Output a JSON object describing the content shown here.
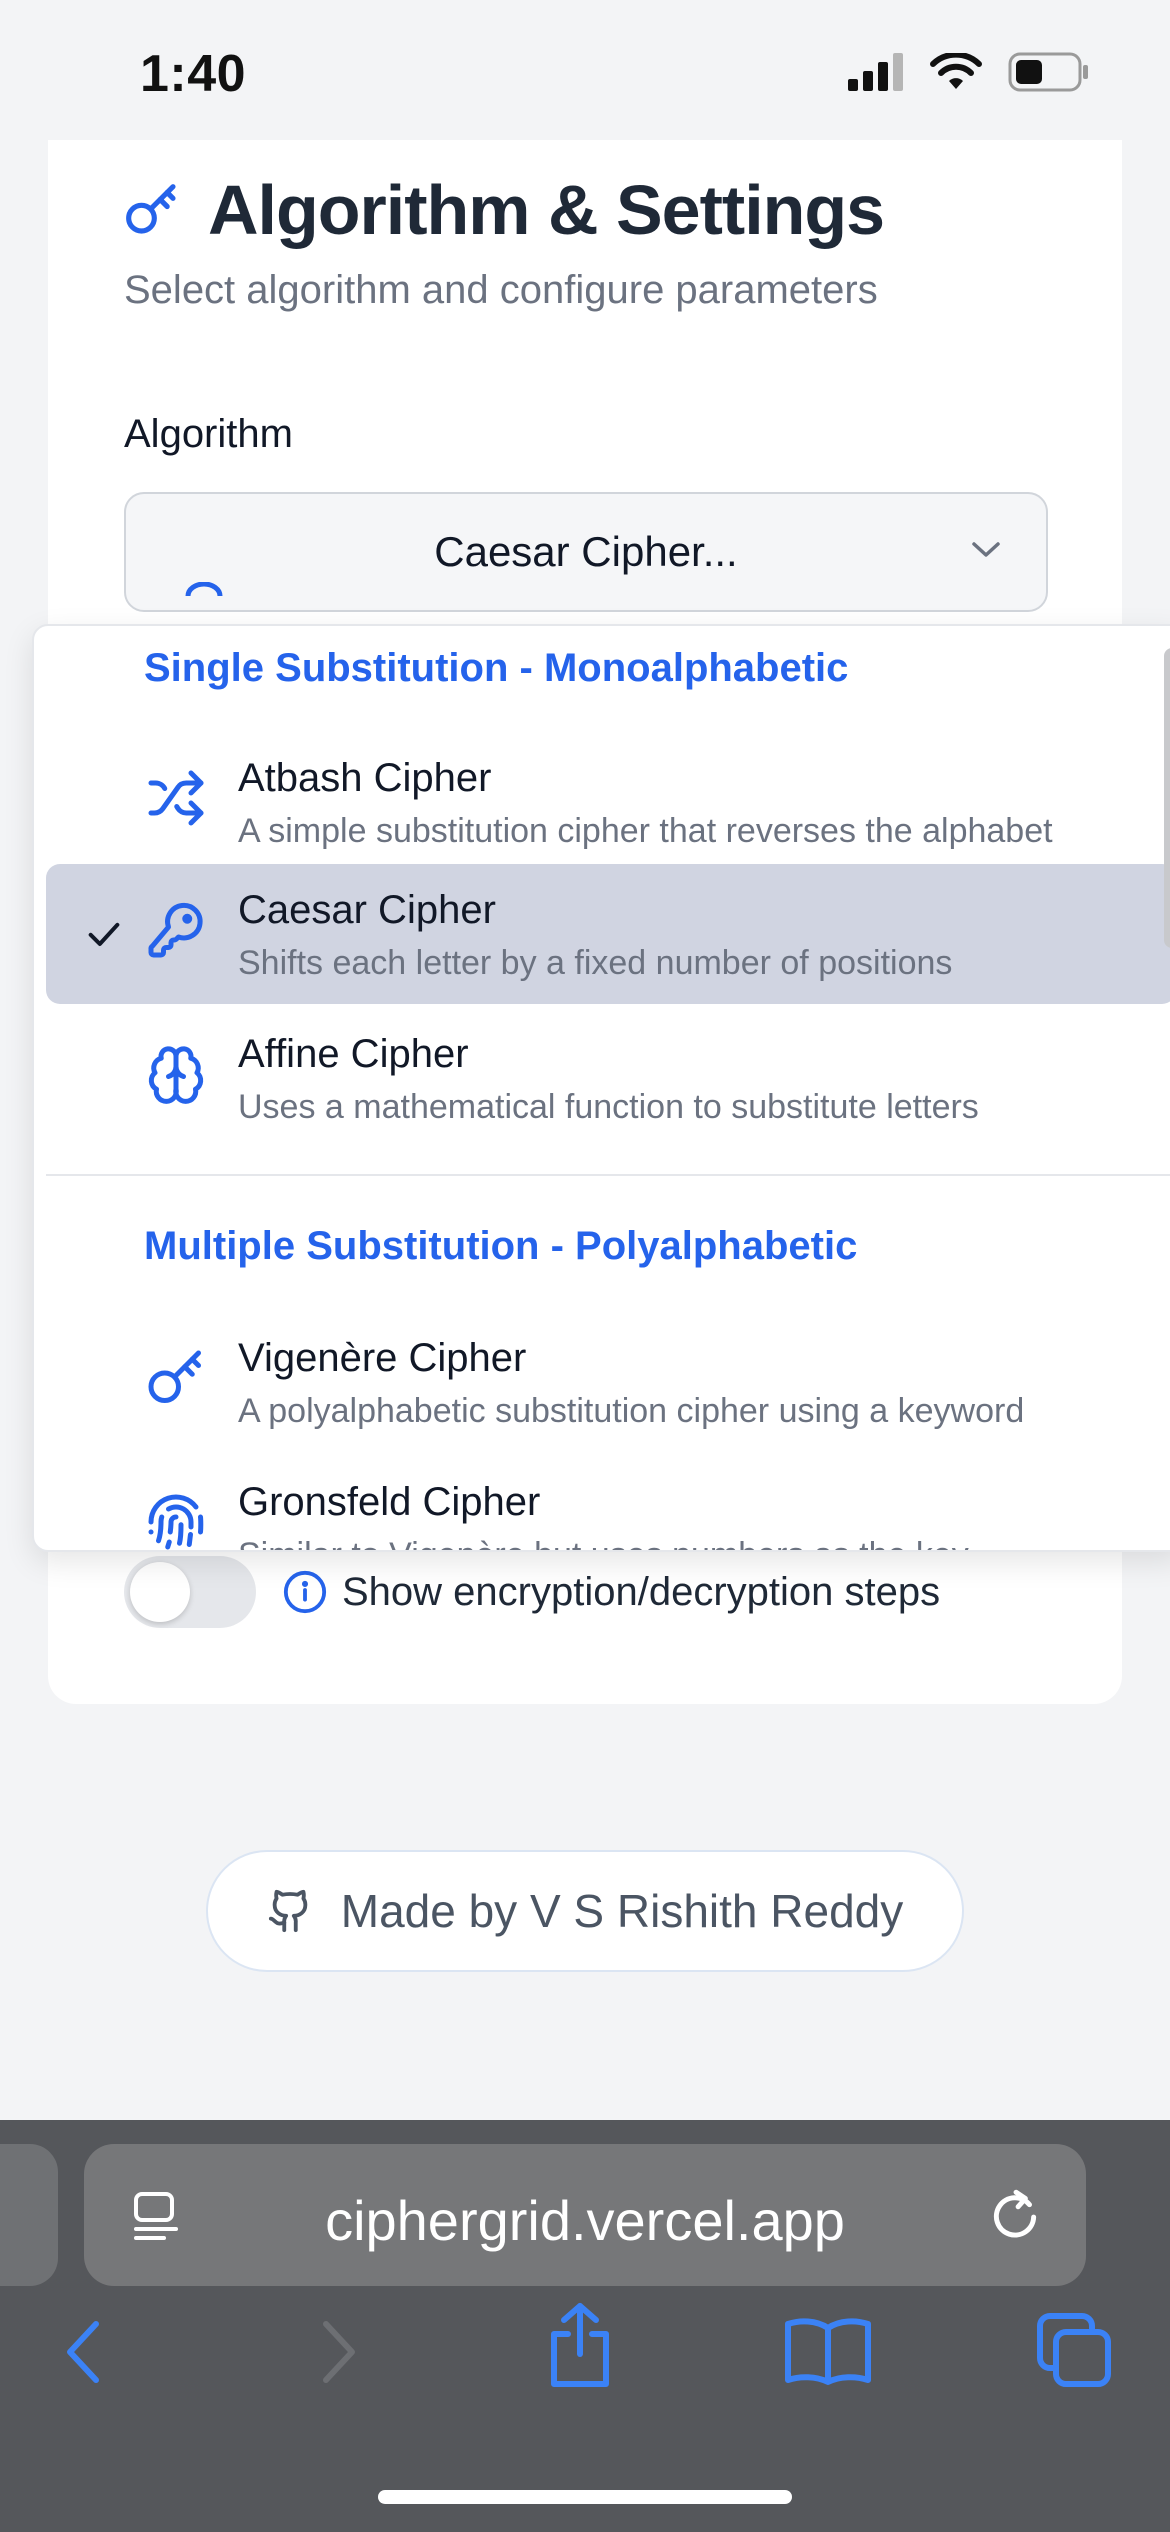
{
  "status_bar": {
    "time": "1:40",
    "icons": [
      "cellular-signal-icon",
      "wifi-icon",
      "battery-icon"
    ]
  },
  "settings_card": {
    "title": "Algorithm & Settings",
    "title_icon": "key-icon",
    "subtitle": "Select algorithm and configure parameters",
    "algorithm_label": "Algorithm",
    "selected_value": "Caesar Cipher...",
    "show_steps_label": "Show encryption/decryption steps",
    "show_steps_enabled": false
  },
  "dropdown": {
    "groups": [
      {
        "title": "Single Substitution - Monoalphabetic",
        "options": [
          {
            "name": "Atbash Cipher",
            "description": "A simple substitution cipher that reverses the alphabet",
            "icon": "shuffle-icon",
            "selected": false
          },
          {
            "name": "Caesar Cipher",
            "description": "Shifts each letter by a fixed number of positions",
            "icon": "key-icon",
            "selected": true
          },
          {
            "name": "Affine Cipher",
            "description": "Uses a mathematical function to substitute letters",
            "icon": "brain-icon",
            "selected": false
          }
        ]
      },
      {
        "title": "Multiple Substitution - Polyalphabetic",
        "options": [
          {
            "name": "Vigenère Cipher",
            "description": "A polyalphabetic substitution cipher using a keyword",
            "icon": "key-icon",
            "selected": false
          },
          {
            "name": "Gronsfeld Cipher",
            "description": "Similar to Vigenère but uses numbers as the key",
            "icon": "fingerprint-icon",
            "selected": false
          }
        ]
      }
    ]
  },
  "footer": {
    "text": "Made by V S Rishith Reddy",
    "icon": "github-icon"
  },
  "browser": {
    "url": "ciphergrid.vercel.app",
    "toolbar": [
      "back-icon",
      "forward-icon",
      "share-icon",
      "bookmarks-icon",
      "tabs-icon"
    ]
  },
  "colors": {
    "accent": "#2563eb",
    "selected_row": "#d0d4e1",
    "safari_bar": "#55575b"
  }
}
